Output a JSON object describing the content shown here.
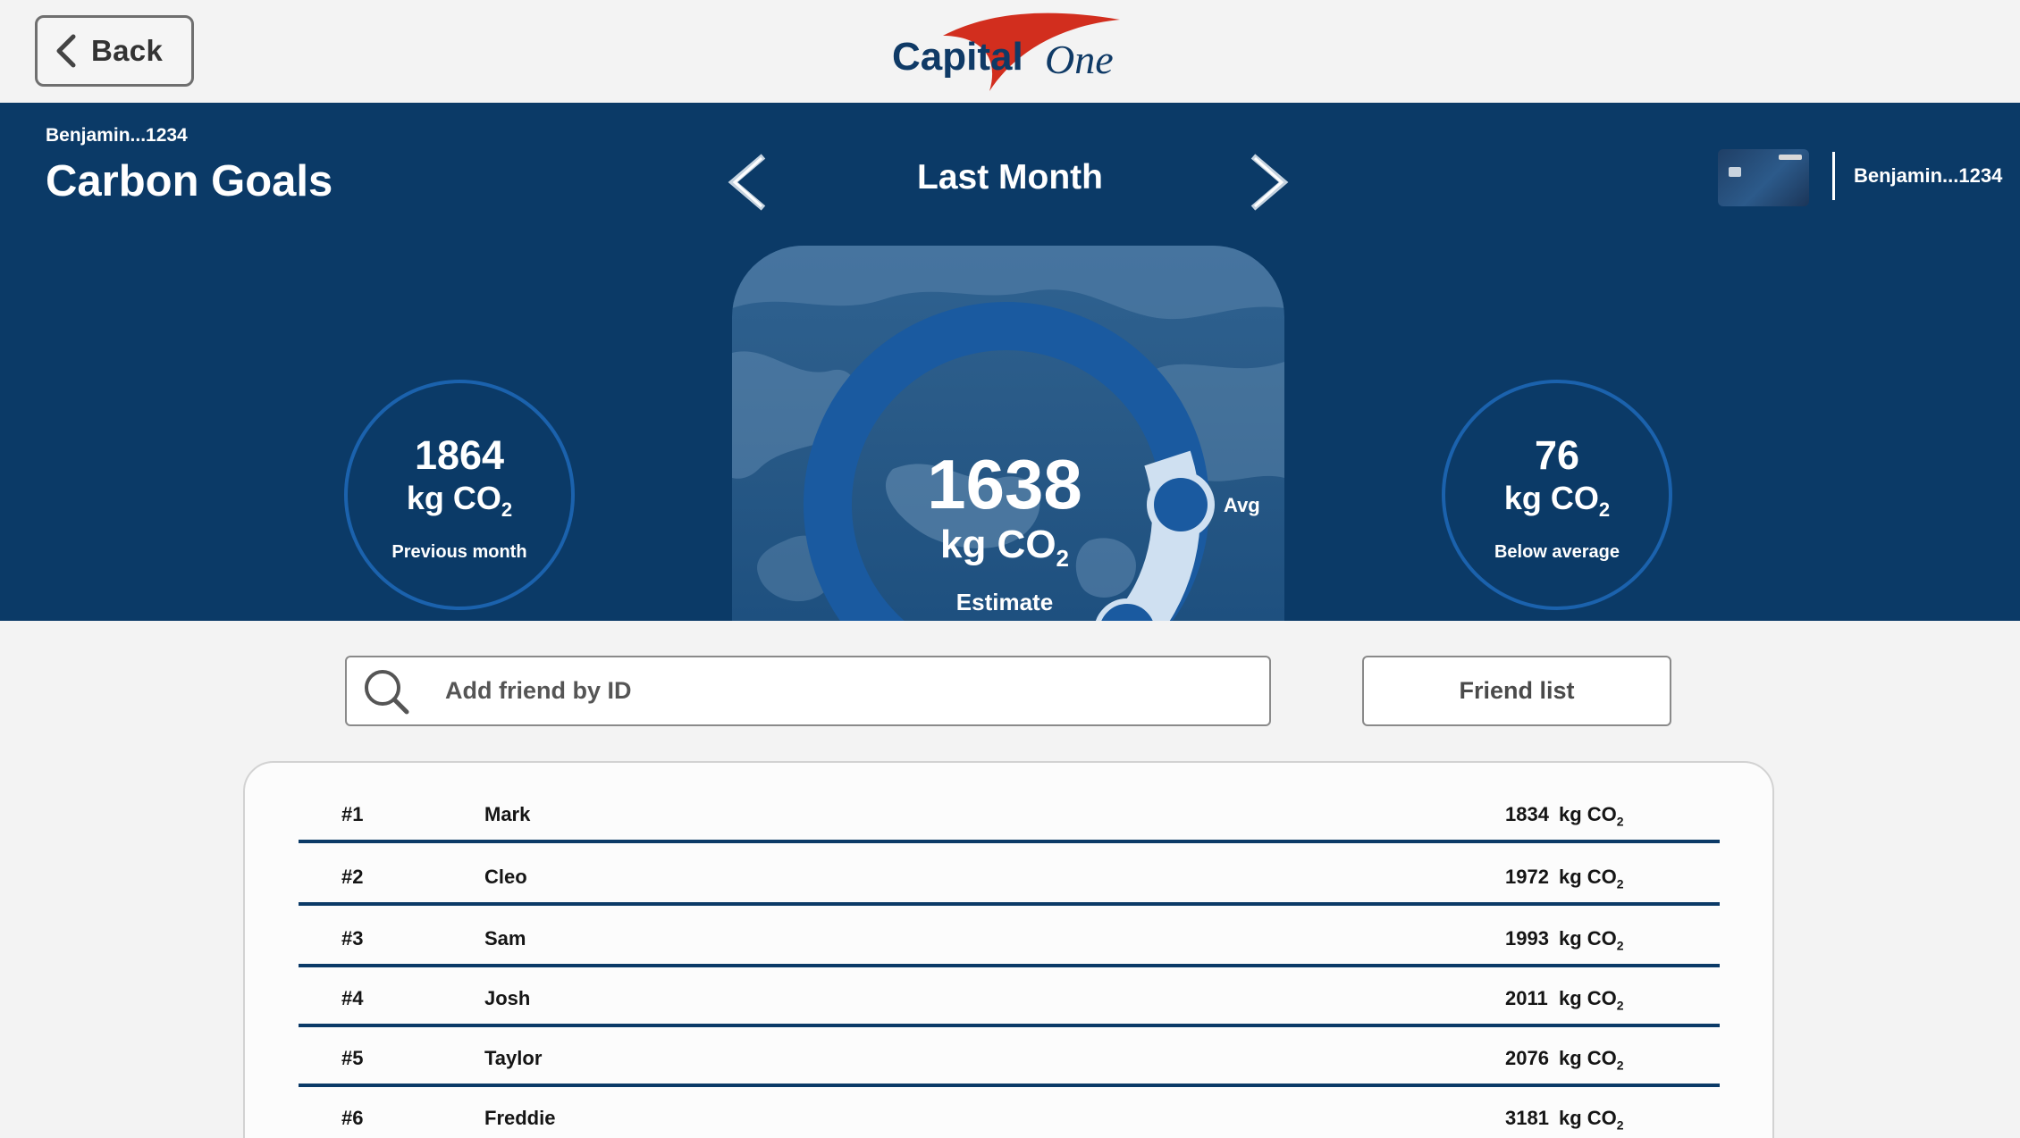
{
  "header": {
    "back_label": "Back",
    "logo_text_1": "Capital",
    "logo_text_2": "One"
  },
  "hero": {
    "account_small": "Benjamin...1234",
    "title": "Carbon Goals",
    "period": "Last Month",
    "account_right": "Benjamin...1234",
    "left_stat": {
      "value": "1864",
      "unit": "kg CO",
      "unit_sub": "2",
      "caption": "Previous month"
    },
    "right_stat": {
      "value": "76",
      "unit": "kg CO",
      "unit_sub": "2",
      "caption": "Below average"
    },
    "gauge": {
      "value": "1638",
      "unit": "kg CO",
      "unit_sub": "2",
      "caption": "Estimate",
      "avg_label": "Avg"
    }
  },
  "search": {
    "placeholder": "Add friend by ID"
  },
  "friend_list_label": "Friend list",
  "leaderboard": {
    "unit": "kg CO",
    "unit_sub": "2",
    "rows": [
      {
        "rank": "#1",
        "name": "Mark",
        "value": "1834"
      },
      {
        "rank": "#2",
        "name": "Cleo",
        "value": "1972"
      },
      {
        "rank": "#3",
        "name": "Sam",
        "value": "1993"
      },
      {
        "rank": "#4",
        "name": "Josh",
        "value": "2011"
      },
      {
        "rank": "#5",
        "name": "Taylor",
        "value": "2076"
      },
      {
        "rank": "#6",
        "name": "Freddie",
        "value": "3181"
      }
    ]
  },
  "colors": {
    "hero_bg": "#0b3a67",
    "accent_blue": "#1b62ad",
    "logo_red": "#d22e1e",
    "logo_navy": "#0f3a66"
  }
}
